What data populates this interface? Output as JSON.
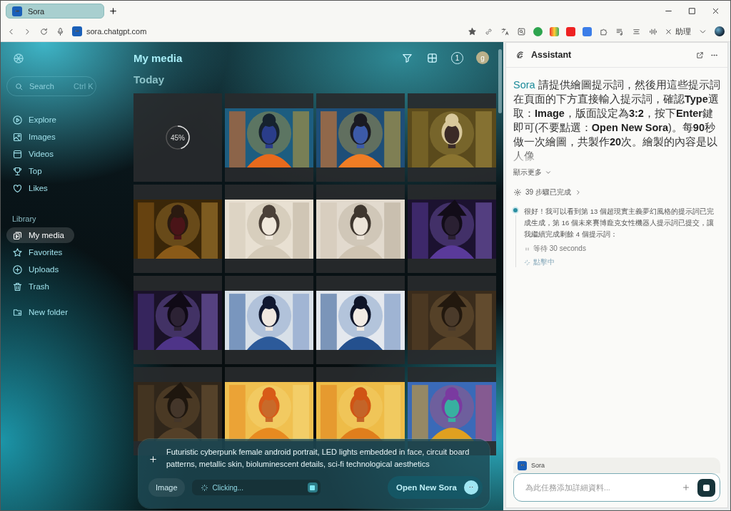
{
  "browser": {
    "tab": {
      "title": "Sora"
    },
    "url": "sora.chatgpt.com",
    "assistant_button": "助理"
  },
  "sidebar": {
    "search": {
      "placeholder": "Search",
      "shortcut": "Ctrl K"
    },
    "nav": [
      {
        "label": "Explore",
        "selected": false
      },
      {
        "label": "Images",
        "selected": false
      },
      {
        "label": "Videos",
        "selected": false
      },
      {
        "label": "Top",
        "selected": false
      },
      {
        "label": "Likes",
        "selected": false
      }
    ],
    "library_heading": "Library",
    "library": [
      {
        "label": "My media",
        "selected": true
      },
      {
        "label": "Favorites",
        "selected": false
      },
      {
        "label": "Uploads",
        "selected": false
      },
      {
        "label": "Trash",
        "selected": false
      }
    ],
    "new_folder": "New folder"
  },
  "main": {
    "title": "My media",
    "notification_count": "1",
    "avatar": "g",
    "section": "Today",
    "media": [
      {
        "kind": "progress",
        "level": 0.45,
        "label": "45%"
      },
      {
        "kind": "picture"
      },
      {
        "kind": "picture"
      },
      {
        "kind": "picture"
      },
      {
        "kind": "picture"
      },
      {
        "kind": "picture"
      },
      {
        "kind": "picture"
      },
      {
        "kind": "picture"
      },
      {
        "kind": "picture"
      },
      {
        "kind": "picture"
      },
      {
        "kind": "picture"
      },
      {
        "kind": "picture"
      },
      {
        "kind": "picture"
      },
      {
        "kind": "picture"
      },
      {
        "kind": "picture"
      },
      {
        "kind": "picture"
      }
    ]
  },
  "composer": {
    "prompt": "Futuristic cyberpunk female android portrait, LED lights embedded in face, circuit board patterns, metallic skin, bioluminescent details, sci-fi technological aesthetics",
    "type_button": "Image",
    "status": "Clicking...",
    "submit": "Open New Sora"
  },
  "assistant": {
    "title": "Assistant",
    "task": {
      "mention": "Sora",
      "text": "請提供繪圖提示詞，然後用這些提示詞在頁面的下方直接輸入提示詞，確認**Type**選取：**Image**，版面設定為**3:2**，按下**Enter**鍵即可(不要點選：**Open New Sora**)。每**90**秒做一次繪圖，共製作**20**次。繪製的內容是以人像"
    },
    "show_more": "顯示更多",
    "steps": "39 步驟已完成",
    "message": "很好！我可以看到第 13 個超現實主義夢幻風格的提示詞已完成生成，第 16 個未來賽博龐克女性機器人提示詞已提交，讓我繼續完成剩餘 4 個提示詞：",
    "activities": [
      {
        "kind": "wait",
        "label": "等待 30 seconds"
      },
      {
        "kind": "click",
        "label": "點擊中"
      }
    ],
    "context_tag": "Sora",
    "input": {
      "placeholder": "為此任務添加詳細資料..."
    }
  }
}
